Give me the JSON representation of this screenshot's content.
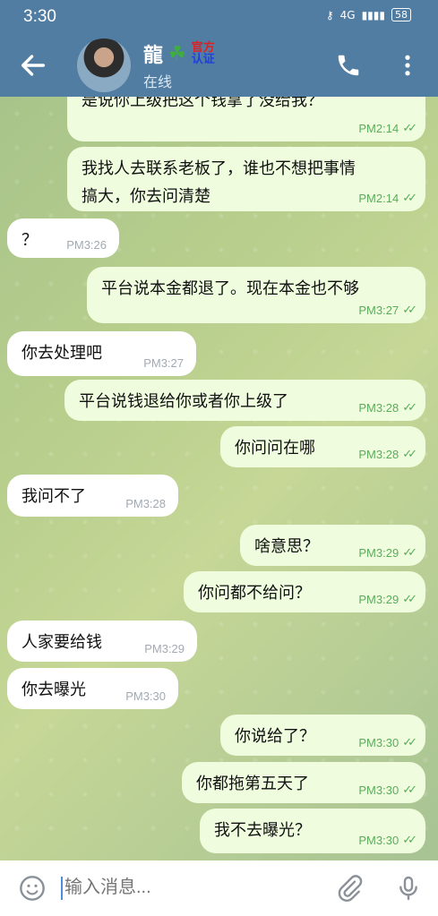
{
  "status": {
    "time": "3:30",
    "network": "4G",
    "battery": "58"
  },
  "header": {
    "name": "龍",
    "badge_line1": "官方",
    "badge_line2": "认证",
    "subtitle": "在线"
  },
  "messages": [
    {
      "dir": "out",
      "text": "是说你上级把这个钱拿了没给我？",
      "time": "PM2:14"
    },
    {
      "dir": "out",
      "text": "我找人去联系老板了，谁也不想把事情\n搞大，你去问清楚",
      "time": "PM2:14"
    },
    {
      "dir": "in",
      "text": "？",
      "time": "PM3:26"
    },
    {
      "dir": "out",
      "text": "平台说本金都退了。现在本金也不够",
      "time": "PM3:27"
    },
    {
      "dir": "in",
      "text": "你去处理吧",
      "time": "PM3:27"
    },
    {
      "dir": "out",
      "text": "平台说钱退给你或者你上级了",
      "time": "PM3:28"
    },
    {
      "dir": "out",
      "text": "你问问在哪",
      "time": "PM3:28"
    },
    {
      "dir": "in",
      "text": "我问不了",
      "time": "PM3:28"
    },
    {
      "dir": "out",
      "text": "啥意思？",
      "time": "PM3:29"
    },
    {
      "dir": "out",
      "text": "你问都不给问？",
      "time": "PM3:29"
    },
    {
      "dir": "in",
      "text": "人家要给钱",
      "time": "PM3:29"
    },
    {
      "dir": "in",
      "text": "你去曝光",
      "time": "PM3:30"
    },
    {
      "dir": "out",
      "text": "你说给了？",
      "time": "PM3:30"
    },
    {
      "dir": "out",
      "text": "你都拖第五天了",
      "time": "PM3:30"
    },
    {
      "dir": "out",
      "text": "我不去曝光？",
      "time": "PM3:30"
    }
  ],
  "composer": {
    "placeholder": "输入消息..."
  }
}
